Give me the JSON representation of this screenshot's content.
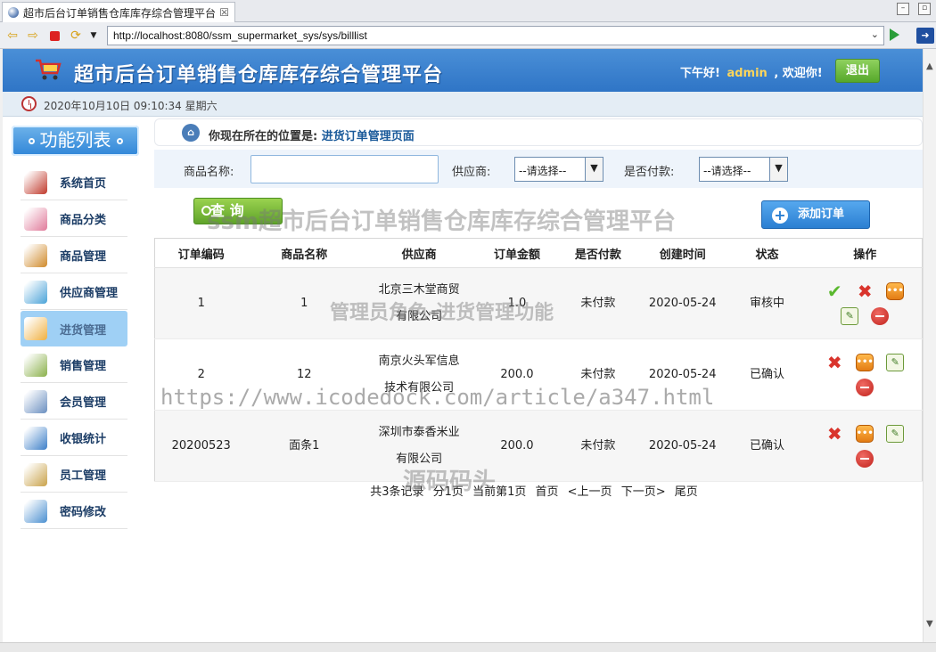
{
  "browser": {
    "tab_title": "超市后台订单销售仓库库存综合管理平台",
    "tab_close": "☒",
    "url": "http://localhost:8080/ssm_supermarket_sys/sys/billlist"
  },
  "header": {
    "title": "超市后台订单销售仓库库存综合管理平台",
    "greeting_prefix": "下午好!",
    "username": "admin",
    "greeting_suffix": ", 欢迎你!",
    "logout_label": "退出"
  },
  "datetime": "2020年10月10日 09:10:34 星期六",
  "sidebar": {
    "heading": "功能列表",
    "items": [
      {
        "label": "系统首页",
        "icon": "home-icon"
      },
      {
        "label": "商品分类",
        "icon": "category-icon"
      },
      {
        "label": "商品管理",
        "icon": "goods-icon"
      },
      {
        "label": "供应商管理",
        "icon": "supplier-icon"
      },
      {
        "label": "进货管理",
        "icon": "purchase-icon",
        "active": true
      },
      {
        "label": "销售管理",
        "icon": "sales-icon"
      },
      {
        "label": "会员管理",
        "icon": "members-icon"
      },
      {
        "label": "收银统计",
        "icon": "cashier-icon"
      },
      {
        "label": "员工管理",
        "icon": "staff-icon"
      },
      {
        "label": "密码修改",
        "icon": "password-icon"
      }
    ]
  },
  "location": {
    "prefix": "你现在所在的位置是:",
    "page": "进货订单管理页面"
  },
  "search": {
    "product_label": "商品名称:",
    "product_value": "",
    "supplier_label": "供应商:",
    "supplier_selected": "--请选择--",
    "paid_label": "是否付款:",
    "paid_selected": "--请选择--",
    "query_label": "查 询",
    "add_label": "添加订单"
  },
  "table": {
    "columns": [
      "订单编码",
      "商品名称",
      "供应商",
      "订单金额",
      "是否付款",
      "创建时间",
      "状态",
      "操作"
    ],
    "rows": [
      {
        "code": "1",
        "product": "1",
        "supplier": "北京三木堂商贸有限公司",
        "amount": "1.0",
        "paid": "未付款",
        "created": "2020-05-24",
        "status": "审核中",
        "ops": [
          "approve",
          "delete",
          "view",
          "edit",
          "remove"
        ]
      },
      {
        "code": "2",
        "product": "12",
        "supplier": "南京火头军信息技术有限公司",
        "amount": "200.0",
        "paid": "未付款",
        "created": "2020-05-24",
        "status": "已确认",
        "ops": [
          "delete",
          "view",
          "edit",
          "remove"
        ]
      },
      {
        "code": "20200523",
        "product": "面条1",
        "supplier": "深圳市泰香米业有限公司",
        "amount": "200.0",
        "paid": "未付款",
        "created": "2020-05-24",
        "status": "已确认",
        "ops": [
          "delete",
          "view",
          "edit",
          "remove"
        ]
      }
    ]
  },
  "pager": {
    "total": "共3条记录",
    "pages": "分1页",
    "current": "当前第1页",
    "first": "首页",
    "prev": "<上一页",
    "next": "下一页>",
    "last": "尾页"
  },
  "watermarks": {
    "line1": "ssm超市后台订单销售仓库库存综合管理平台",
    "line2": "管理员角色-进货管理功能",
    "line3": "https://www.icodedock.com/article/a347.html",
    "line4": "源码码头"
  }
}
